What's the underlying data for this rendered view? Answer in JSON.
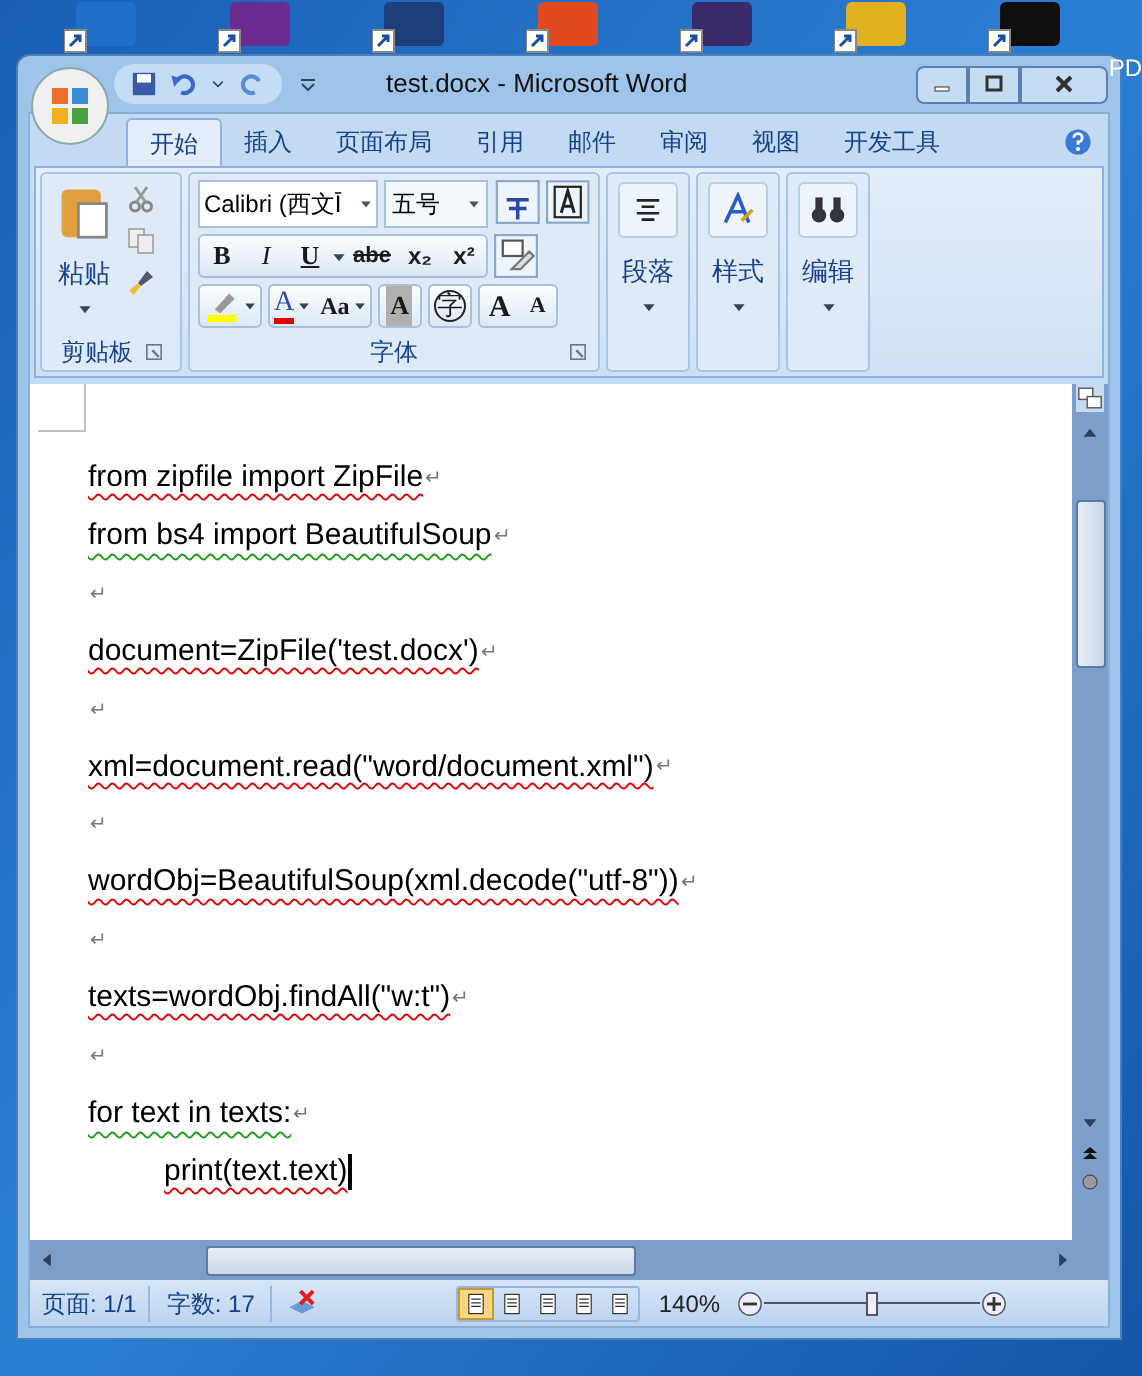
{
  "desktop": {
    "shortcuts": [
      {
        "color": "#1e6fc9"
      },
      {
        "color": "#6a2c91"
      },
      {
        "color": "#1c3f7a"
      },
      {
        "color": "#e04a1c"
      },
      {
        "color": "#3a2a6a"
      },
      {
        "color": "#e0b020"
      },
      {
        "color": "#101010"
      }
    ],
    "edge_label": "PD"
  },
  "window": {
    "title": "test.docx - Microsoft Word"
  },
  "tabs": [
    {
      "label": "开始",
      "selected": true
    },
    {
      "label": "插入",
      "selected": false
    },
    {
      "label": "页面布局",
      "selected": false
    },
    {
      "label": "引用",
      "selected": false
    },
    {
      "label": "邮件",
      "selected": false
    },
    {
      "label": "审阅",
      "selected": false
    },
    {
      "label": "视图",
      "selected": false
    },
    {
      "label": "开发工具",
      "selected": false
    }
  ],
  "ribbon": {
    "clipboard": {
      "paste": "粘贴",
      "group": "剪贴板"
    },
    "font": {
      "name": "Calibri (西文Ī",
      "size": "五号",
      "group": "字体",
      "bold": "B",
      "italic": "I",
      "underline": "U",
      "strike": "abe",
      "sub": "x₂",
      "sup": "x²",
      "color_letter": "A",
      "case": "Aa",
      "shade": "A",
      "enclosed": "字",
      "grow": "A",
      "shrink": "A"
    },
    "groups": [
      {
        "label": "段落",
        "kind": "paragraph"
      },
      {
        "label": "样式",
        "kind": "styles"
      },
      {
        "label": "编辑",
        "kind": "editing"
      }
    ]
  },
  "document": {
    "lines": [
      {
        "text": "from zipfile import ZipFile",
        "end": "↵",
        "spelling_error": true,
        "grammar_error": false,
        "indent": false
      },
      {
        "text": "from bs4 import BeautifulSoup",
        "end": "↵",
        "spelling_error": false,
        "grammar_error": true,
        "indent": false
      },
      {
        "end": "↵"
      },
      {
        "text": "document=ZipFile('test.docx')",
        "end": "↵",
        "spelling_error": true,
        "grammar_error": false,
        "indent": false
      },
      {
        "end": "↵"
      },
      {
        "text": "xml=document.read(\"word/document.xml\")",
        "end": "↵",
        "spelling_error": true,
        "grammar_error": false,
        "indent": false
      },
      {
        "end": "↵"
      },
      {
        "text": "wordObj=BeautifulSoup(xml.decode(\"utf-8\"))",
        "end": "↵",
        "spelling_error": true,
        "grammar_error": false,
        "indent": false
      },
      {
        "end": "↵"
      },
      {
        "text": "texts=wordObj.findAll(\"w:t\")",
        "end": "↵",
        "spelling_error": true,
        "grammar_error": false,
        "indent": false
      },
      {
        "end": "↵"
      },
      {
        "text": "for text in texts:",
        "end": "↵",
        "spelling_error": false,
        "grammar_error": true,
        "indent": false
      },
      {
        "text": "print(text.text)",
        "spelling_error": true,
        "grammar_error": false,
        "indent": true,
        "cursor": true
      }
    ]
  },
  "status_bar": {
    "page": "页面: 1/1",
    "words": "字数: 17",
    "zoom": "140%",
    "zoom_level": {
      "level": 0.5
    },
    "views": [
      {
        "selected": true
      },
      {
        "selected": false
      },
      {
        "selected": false
      },
      {
        "selected": false
      },
      {
        "selected": false
      }
    ]
  }
}
